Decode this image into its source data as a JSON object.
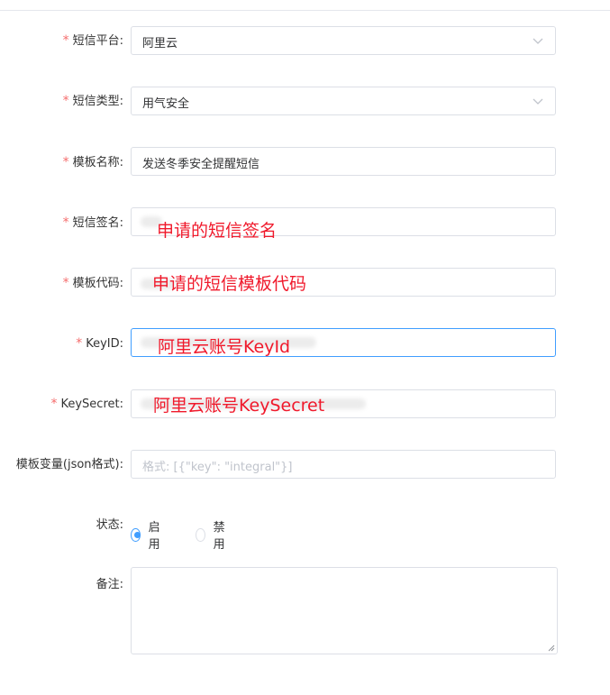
{
  "form": {
    "platform": {
      "label": "短信平台:",
      "value": "阿里云"
    },
    "sms_type": {
      "label": "短信类型:",
      "value": "用气安全"
    },
    "template_name": {
      "label": "模板名称:",
      "value": "发送冬季安全提醒短信"
    },
    "sms_sign": {
      "label": "短信签名:",
      "annotation": "申请的短信签名"
    },
    "template_code": {
      "label": "模板代码:",
      "annotation": "申请的短信模板代码"
    },
    "key_id": {
      "label": "KeyID:",
      "annotation": "阿里云账号KeyId"
    },
    "key_secret": {
      "label": "KeySecret:",
      "annotation": "阿里云账号KeySecret"
    },
    "template_vars": {
      "label": "模板变量(json格式):",
      "placeholder": "格式: [{\"key\": \"integral\"}]"
    },
    "status": {
      "label": "状态:",
      "options": [
        "启用",
        "禁用"
      ],
      "selected": "启用"
    },
    "remark": {
      "label": "备注:"
    }
  },
  "required_mark": "*",
  "colors": {
    "accent": "#409eff",
    "required": "#f56c6c",
    "annotation": "#f0192b"
  }
}
